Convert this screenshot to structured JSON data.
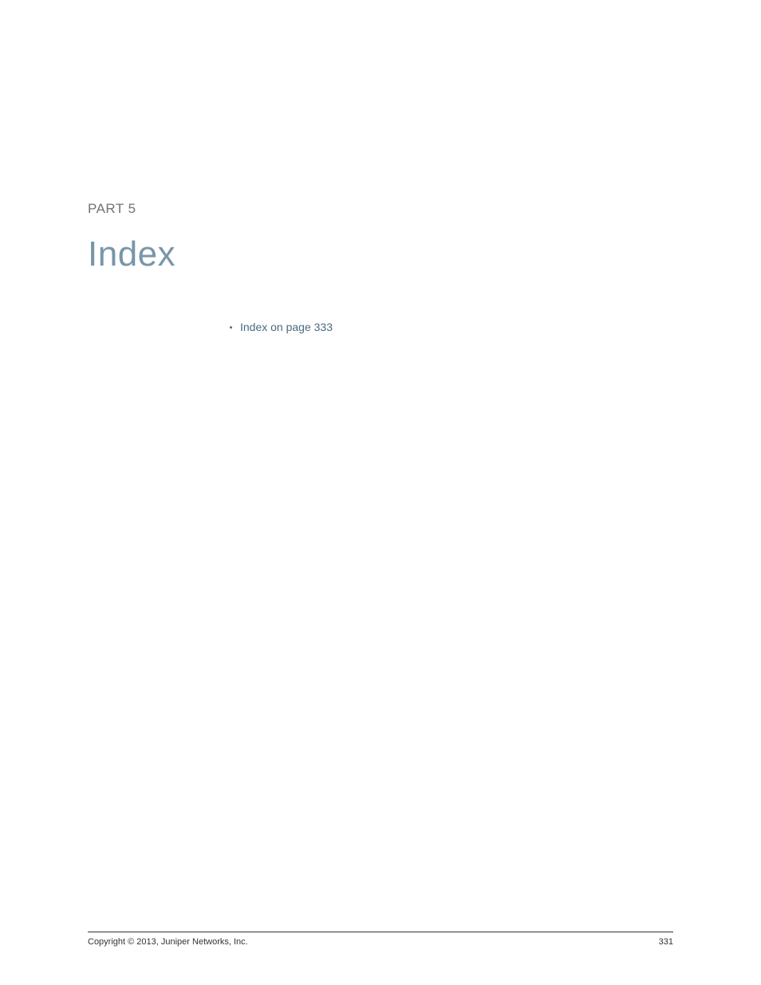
{
  "header": {
    "part_label": "PART 5",
    "title": "Index"
  },
  "content": {
    "bullets": [
      {
        "label": "Index on page 333"
      }
    ]
  },
  "footer": {
    "copyright": "Copyright © 2013, Juniper Networks, Inc.",
    "page_number": "331"
  }
}
